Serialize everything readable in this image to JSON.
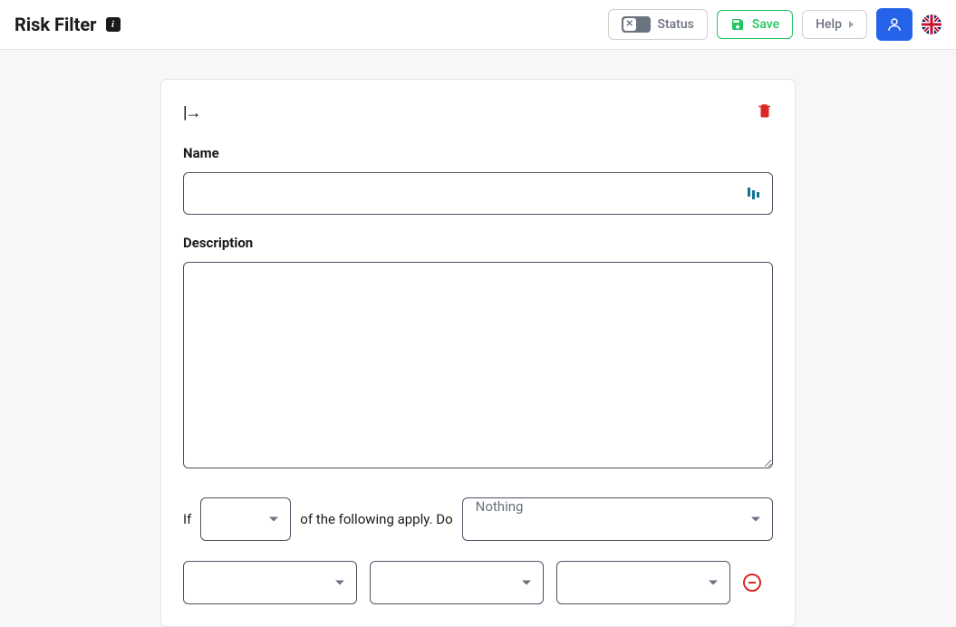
{
  "header": {
    "title": "Risk Filter",
    "status_label": "Status",
    "save_label": "Save",
    "help_label": "Help"
  },
  "form": {
    "name_label": "Name",
    "name_value": "",
    "description_label": "Description",
    "description_value": "",
    "rule": {
      "if_text": "If",
      "condition_mode_value": "",
      "middle_text": "of the following apply. Do",
      "action_value": "Nothing"
    },
    "condition": {
      "field1_value": "",
      "field2_value": "",
      "field3_value": ""
    }
  }
}
